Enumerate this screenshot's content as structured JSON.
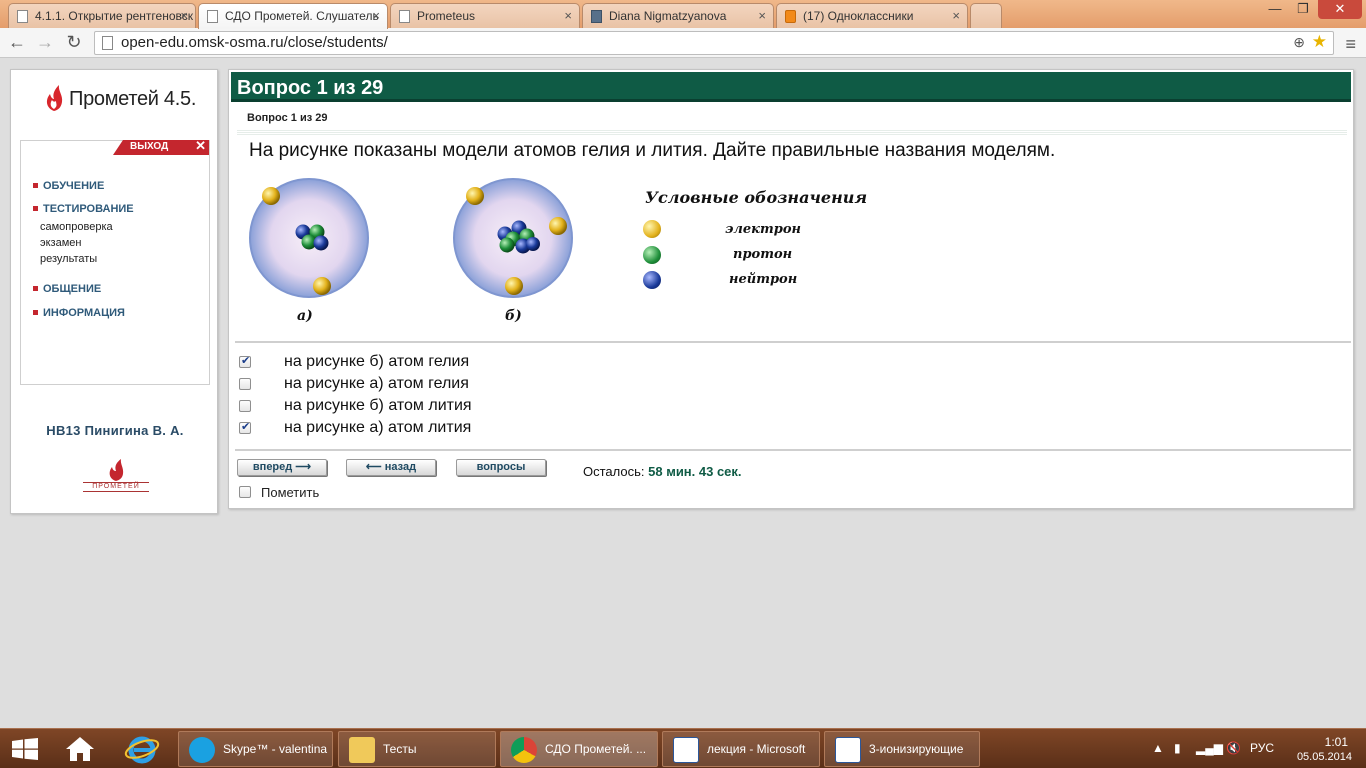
{
  "browser": {
    "tabs": [
      {
        "title": "4.1.1. Открытие рентгеновск",
        "icon": "page-icon",
        "active": false
      },
      {
        "title": "СДО Прометей. Слушатель",
        "icon": "page-icon",
        "active": true
      },
      {
        "title": "Prometeus",
        "icon": "page-icon",
        "active": false
      },
      {
        "title": "Diana Nigmatzyanova",
        "icon": "pause-icon",
        "active": false
      },
      {
        "title": "(17) Одноклассники",
        "icon": "odnoklassniki-icon",
        "active": false
      }
    ],
    "url": "open-edu.omsk-osma.ru/close/students/"
  },
  "sidebar": {
    "logo_text": "Прометей 4.5.",
    "exit_label": "ВЫХОД",
    "menu": {
      "learning": "ОБУЧЕНИЕ",
      "testing": "ТЕСТИРОВАНИЕ",
      "self_check": "самопроверка",
      "exam": "экзамен",
      "results": "результаты",
      "communication": "ОБЩЕНИЕ",
      "information": "ИНФОРМАЦИЯ"
    },
    "username": "НВ13 Пинигина В. А.",
    "bottom_logo_text": "ПРОМЕТЕЙ"
  },
  "question": {
    "header": "Вопрос 1 из 29",
    "subheader": "Вопрос 1 из 29",
    "text": "На рисунке показаны модели атомов гелия и лития. Дайте правильные названия моделям.",
    "figure": {
      "caption_a": "а)",
      "caption_b": "б)",
      "legend_title": "Условные обозначения",
      "legend": {
        "electron": "электрон",
        "proton": "протон",
        "neutron": "нейтрон"
      }
    },
    "answers": [
      {
        "label": "на рисунке б) атом гелия",
        "checked": true
      },
      {
        "label": "на рисунке а) атом гелия",
        "checked": false
      },
      {
        "label": "на рисунке б) атом лития",
        "checked": false
      },
      {
        "label": "на рисунке а) атом лития",
        "checked": true
      }
    ],
    "buttons": {
      "forward": "вперед ⟶",
      "back": "⟵ назад",
      "questions": "вопросы"
    },
    "timer_label": "Осталось:",
    "timer_value": "58 мин. 43 сек.",
    "mark_label": "Пометить"
  },
  "taskbar": {
    "tasks": [
      {
        "label": "Skype™ - valentina",
        "icon": "skype-icon"
      },
      {
        "label": "Тесты",
        "icon": "folder-icon"
      },
      {
        "label": "СДО Прометей. ...",
        "icon": "chrome-icon"
      },
      {
        "label": "лекция - Microsoft",
        "icon": "word-icon"
      },
      {
        "label": "3-ионизирующие",
        "icon": "word-icon"
      }
    ],
    "language": "РУС",
    "time": "1:01",
    "date": "05.05.2014"
  },
  "colors": {
    "header_green": "#0f5b45",
    "accent_red": "#c4262e",
    "electron": "#e3b21c",
    "proton": "#1f8f3a",
    "neutron": "#1a3a9a"
  }
}
